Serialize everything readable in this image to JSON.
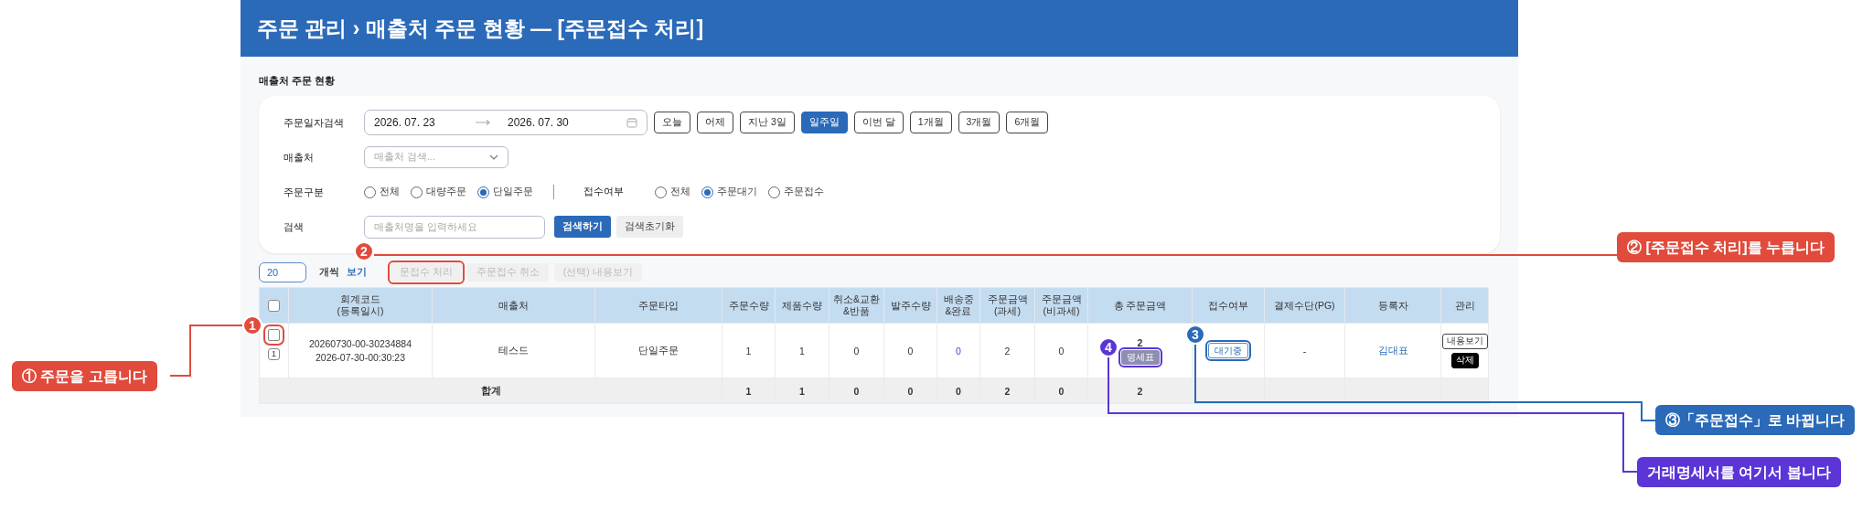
{
  "title": "주문 관리 › 매출처 주문 현황 — [주문접수 처리]",
  "section_title": "매출처 주문 현황",
  "filters": {
    "date": {
      "label": "주문일자검색",
      "start": "2026. 07. 23",
      "end": "2026. 07. 30",
      "ranges": [
        {
          "label": "오늘",
          "selected": false
        },
        {
          "label": "어제",
          "selected": false
        },
        {
          "label": "지난 3일",
          "selected": false
        },
        {
          "label": "일주일",
          "selected": true
        },
        {
          "label": "이번 달",
          "selected": false
        },
        {
          "label": "1개월",
          "selected": false
        },
        {
          "label": "3개월",
          "selected": false
        },
        {
          "label": "6개월",
          "selected": false
        }
      ]
    },
    "vendor": {
      "label": "매출처",
      "placeholder": "매출처 검색..."
    },
    "order_type": {
      "label": "주문구분",
      "options": [
        {
          "label": "전체",
          "selected": false
        },
        {
          "label": "대량주문",
          "selected": false
        },
        {
          "label": "단일주문",
          "selected": true
        }
      ]
    },
    "receipt": {
      "label": "접수여부",
      "options": [
        {
          "label": "전체",
          "selected": false
        },
        {
          "label": "주문대기",
          "selected": true
        },
        {
          "label": "주문접수",
          "selected": false
        }
      ]
    },
    "search": {
      "label": "검색",
      "placeholder": "매출처명을 입력하세요",
      "buttons": [
        {
          "label": "검색하기",
          "kind": "primary"
        },
        {
          "label": "검색초기화",
          "kind": "secondary"
        }
      ]
    }
  },
  "toolbar": {
    "page_size": "20",
    "page_size_label": "개씩",
    "view_link": "보기",
    "buttons": [
      {
        "label": "문접수 처리",
        "disabled": true
      },
      {
        "label": "주문접수 취소",
        "disabled": true
      },
      {
        "label": "(선택) 내용보기",
        "disabled": true
      }
    ]
  },
  "table": {
    "header_checked": false,
    "columns": [
      "회계코드\n(등록일시)",
      "매출처",
      "주문타입",
      "주문수량",
      "제품수량",
      "취소&교환\n&반품",
      "발주수량",
      "배송중\n&완료",
      "주문금액\n(과세)",
      "주문금액\n(비과세)",
      "총 주문금액",
      "접수여부",
      "결제수단(PG)",
      "등록자",
      "관리"
    ],
    "rows": [
      {
        "checked": false,
        "number": "1",
        "cells": [
          {
            "kind": "lines",
            "lines": [
              "20260730-00-30234884",
              "2026-07-30-00:30:23"
            ]
          },
          {
            "kind": "text",
            "text": "테스드"
          },
          {
            "kind": "text",
            "text": "단일주문"
          },
          {
            "kind": "text",
            "text": "1"
          },
          {
            "kind": "text",
            "text": "1"
          },
          {
            "kind": "text",
            "text": "0"
          },
          {
            "kind": "text",
            "text": "0"
          },
          {
            "kind": "link",
            "text": "0"
          },
          {
            "kind": "text",
            "text": "2"
          },
          {
            "kind": "text",
            "text": "0"
          },
          {
            "kind": "amount",
            "text": "2",
            "button": "명세표"
          },
          {
            "kind": "status",
            "text": "대기중"
          },
          {
            "kind": "text",
            "text": "-"
          },
          {
            "kind": "link",
            "text": "김대표"
          },
          {
            "kind": "actions",
            "buttons": [
              {
                "label": "내용보기",
                "kind": "outline"
              },
              {
                "label": "삭제",
                "kind": "dark"
              }
            ]
          }
        ]
      }
    ],
    "totals": {
      "label": "합계",
      "values": [
        "1",
        "1",
        "0",
        "0",
        "0",
        "2",
        "0",
        "2"
      ]
    }
  },
  "annotations": [
    {
      "badge": "1",
      "text": "① 주문을 고릅니다",
      "color": "#e04b3c"
    },
    {
      "badge": "2",
      "text": "② [주문접수 처리]를 누릅니다",
      "color": "#e04b3c"
    },
    {
      "badge": "3",
      "text": "③「주문접수」로 바뀝니다",
      "color": "#2a6ab8"
    },
    {
      "badge": "4",
      "text": "거래명세서를 여기서 봅니다",
      "color": "#5b35d5"
    }
  ]
}
